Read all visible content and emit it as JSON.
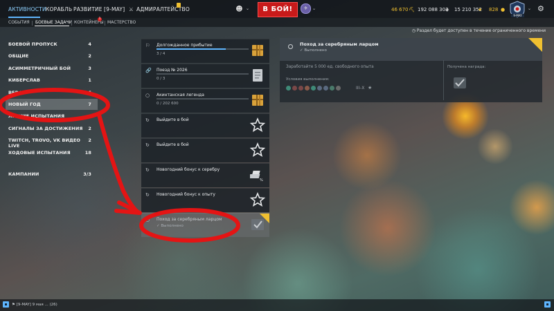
{
  "nav": {
    "items": [
      "АКТИВНОСТИ",
      "КОРАБЛЬ",
      "РАЗВИТИЕ",
      "[9-MAY]",
      "АДМИРАЛТЕЙСТВО"
    ],
    "battle_label": "В БОЙ!",
    "help": "?"
  },
  "currencies": {
    "coal": "46 670",
    "credits": "192 088 303",
    "free_xp": "15 210 352",
    "gold": "828"
  },
  "profile_label": "9-MAY",
  "subtabs": {
    "items": [
      "СОБЫТИЯ",
      "БОЕВЫЕ ЗАДАЧИ",
      "КОНТЕЙНЕРЫ",
      "МАСТЕРСТВО"
    ],
    "badge": "1"
  },
  "notice": "Раздел будет доступен в течение ограниченного времени",
  "sidebar": {
    "categories": [
      {
        "label": "БОЕВОЙ ПРОПУСК",
        "count": "4"
      },
      {
        "label": "ОБЩИЕ",
        "count": "2"
      },
      {
        "label": "АСИММЕТРИЧНЫЙ БОЙ",
        "count": "3"
      },
      {
        "label": "КИБЕРСЛАВ",
        "count": "1"
      },
      {
        "label": "ВЕРФЬ",
        "count": "6"
      },
      {
        "label": "НОВЫЙ ГОД",
        "count": "7"
      },
      {
        "label": "ЛЕТНИЕ ИСПЫТАНИЯ",
        "count": ""
      },
      {
        "label": "СИГНАЛЫ ЗА ДОСТИЖЕНИЯ",
        "count": "2"
      },
      {
        "label": "TWITCH, TROVO, VK ВИДЕО LIVE",
        "count": "2"
      },
      {
        "label": "ХОДОВЫЕ ИСПЫТАНИЯ",
        "count": "18"
      },
      {
        "label": "КАМПАНИИ",
        "count": "3/3"
      }
    ]
  },
  "tasks": [
    {
      "title": "Долгожданное прибытие",
      "progress": "3 / 4",
      "fill": 0.75,
      "icon": "flag-icon",
      "reward": "chest-icon"
    },
    {
      "title": "Поезд № 2026",
      "progress": "0 / 3",
      "fill": 0,
      "icon": "link-icon",
      "reward": "document-icon"
    },
    {
      "title": "Акинтанская легенда",
      "progress": "0 / 202 600",
      "fill": 0,
      "icon": "circle-icon",
      "reward": "chest-icon"
    },
    {
      "title": "Выйдите в бой",
      "progress": "",
      "fill": null,
      "icon": "repeat-icon",
      "reward": "star-icon"
    },
    {
      "title": "Выйдите в бой",
      "progress": "",
      "fill": null,
      "icon": "repeat-icon",
      "reward": "star-icon"
    },
    {
      "title": "Новогодний бонус к серебру",
      "progress": "",
      "fill": null,
      "icon": "repeat-icon",
      "reward": "silver-icon"
    },
    {
      "title": "Новогодний бонус к опыту",
      "progress": "",
      "fill": null,
      "icon": "repeat-icon",
      "reward": "star-icon"
    },
    {
      "title": "Поход за серебряным ларцом",
      "progress": "Выполнено",
      "fill": null,
      "icon": "circle-icon",
      "reward": "check-icon"
    }
  ],
  "detail": {
    "title": "Поход за серебряным ларцом",
    "status": "Выполнено",
    "description": "Заработайте 5 000 ед. свободного опыта",
    "conditions_label": "Условия выполнения:",
    "tiers": "III–X",
    "reward_label": "Получена награда:"
  },
  "bottom": {
    "chat": "[9-MAY] 9 мая ... (26)"
  },
  "colors": {
    "accent": "#5fb6ff",
    "battle": "#c81a1a",
    "annotation": "#e41414",
    "gold": "#f0c030"
  }
}
